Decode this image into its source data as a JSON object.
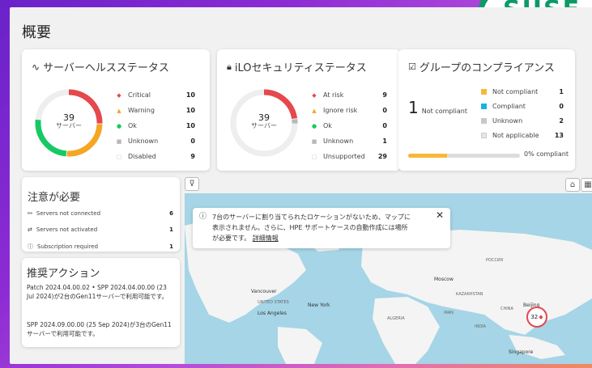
{
  "page_title": "概要",
  "logo_text": "SUSE",
  "health": {
    "title": "サーバーヘルスステータス",
    "donut_value": "39",
    "donut_label": "サーバー",
    "rows": [
      {
        "label": "Critical",
        "value": "10",
        "color": "#e5484d",
        "icon": "diamond"
      },
      {
        "label": "Warning",
        "value": "10",
        "color": "#f5a623",
        "icon": "triangle"
      },
      {
        "label": "Ok",
        "value": "10",
        "color": "#17c964",
        "icon": "circle"
      },
      {
        "label": "Unknown",
        "value": "0",
        "color": "#b8b8b8",
        "icon": "square"
      },
      {
        "label": "Disabled",
        "value": "9",
        "color": "#d0d0d0",
        "icon": "square-outline"
      }
    ]
  },
  "ilo": {
    "title": "iLOセキュリティステータス",
    "donut_value": "39",
    "donut_label": "サーバー",
    "rows": [
      {
        "label": "At risk",
        "value": "9",
        "color": "#e5484d",
        "icon": "diamond"
      },
      {
        "label": "Ignore risk",
        "value": "0",
        "color": "#f5a623",
        "icon": "triangle"
      },
      {
        "label": "Ok",
        "value": "0",
        "color": "#17c964",
        "icon": "circle"
      },
      {
        "label": "Unknown",
        "value": "1",
        "color": "#b8b8b8",
        "icon": "square"
      },
      {
        "label": "Unsupported",
        "value": "29",
        "color": "#d0d0d0",
        "icon": "square-outline"
      }
    ]
  },
  "compliance": {
    "title": "グループのコンプライアンス",
    "big_number": "1",
    "big_label": "Not compliant",
    "rows": [
      {
        "label": "Not compliant",
        "value": "1",
        "color": "#f7b838"
      },
      {
        "label": "Compliant",
        "value": "0",
        "color": "#19b2e6"
      },
      {
        "label": "Unknown",
        "value": "2",
        "color": "#c8c8c8"
      },
      {
        "label": "Not applicable",
        "value": "13",
        "color": "#e6e6e6"
      }
    ],
    "progress_label": "0% compliant"
  },
  "attention": {
    "title": "注意が必要",
    "rows": [
      {
        "label": "Servers not connected",
        "value": "6"
      },
      {
        "label": "Servers not activated",
        "value": "1"
      },
      {
        "label": "Subscription required",
        "value": "1"
      }
    ]
  },
  "actions": {
    "title": "推奨アクション",
    "items": [
      "Patch 2024.04.00.02 • SPP 2024.04.00.00 (23 Jul 2024)が2台のGen11サーバーで利用可能です。",
      "SPP 2024.09.00.00 (25 Sep 2024)が3台のGen11サーバーで利用可能です。"
    ]
  },
  "map": {
    "toast_line1": "7台のサーバーに割り当てられたロケーションがないため、マップに",
    "toast_line2": "表示されません。さらに、HPE サポートケースの自動作成には場所",
    "toast_line3": "が必要です。",
    "toast_link": "詳細情報",
    "marker_count": "32",
    "labels": [
      "Vancouver",
      "New York",
      "Los Angeles",
      "Moscow",
      "KAZAKHSTAN",
      "IRAN",
      "INDIA",
      "CHINA",
      "Beijing",
      "Singapore",
      "ALGERIA",
      "UNITED STATES",
      "РОССИЯ"
    ]
  }
}
